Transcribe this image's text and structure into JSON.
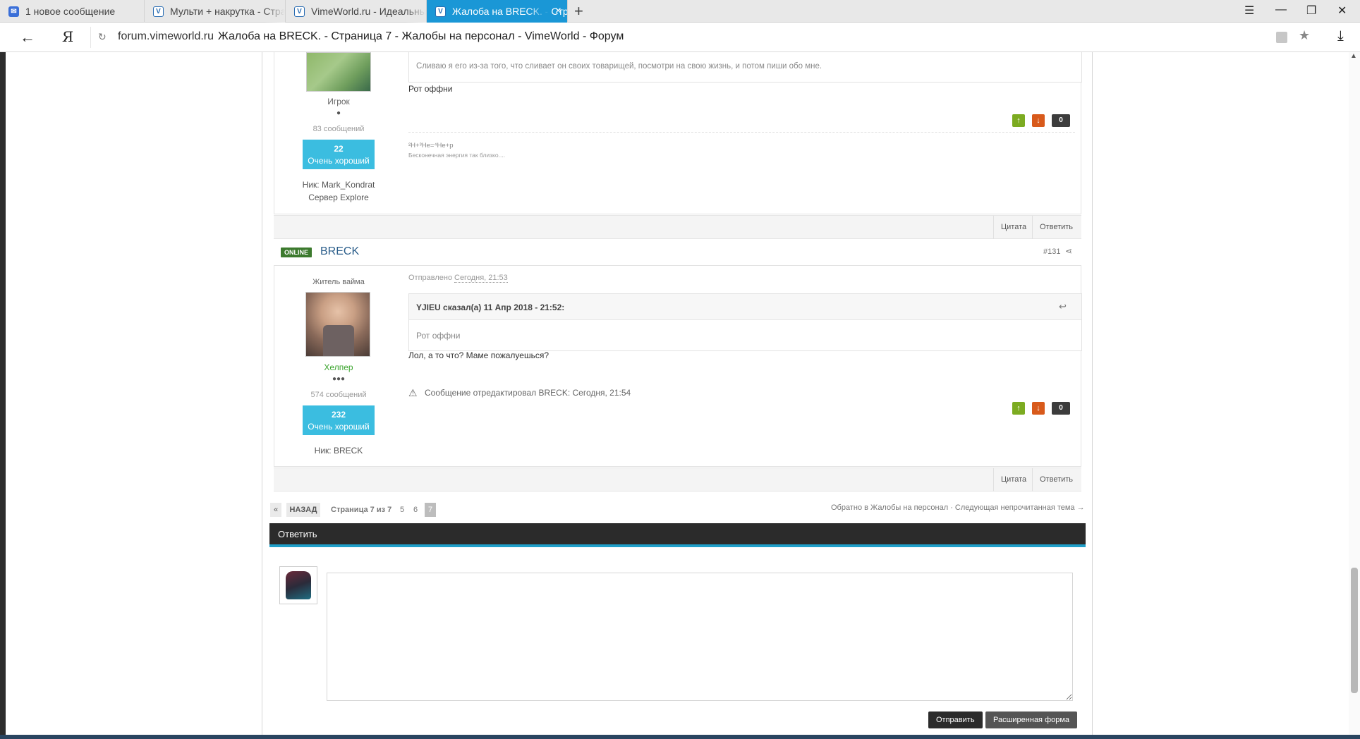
{
  "browser": {
    "tabs": [
      {
        "title": "1 новое сообщение",
        "icon": "mail-icon"
      },
      {
        "title": "Мульти + накрутка - Стран",
        "icon": "vimeworld-icon"
      },
      {
        "title": "VimeWorld.ru - Идеальные",
        "icon": "vimeworld-icon"
      },
      {
        "title": "Жалоба на BRECK. - Стра",
        "icon": "vimeworld-icon",
        "active": true
      }
    ],
    "new_tab": "+",
    "back": "←",
    "yandex": "Я",
    "reload": "↻",
    "domain": "forum.vimeworld.ru",
    "page_title": "Жалоба на BRECK. - Страница 7 - Жалобы на персонал - VimeWorld - Форум",
    "menu": "☰",
    "minimize": "—",
    "restore": "❐",
    "close": "✕",
    "star": "★",
    "download": "⤓"
  },
  "post1": {
    "rank": "Игрок",
    "pips": "●",
    "posts": "83 сообщений",
    "rep_value": "22",
    "rep_label": "Очень хороший",
    "nick": "Ник: Mark_Kondrat",
    "server": "Сервер Explore",
    "quote_text": "Сливаю я его из-за того, что сливает он своих товарищей, посмотри на свою жизнь, и потом пиши обо мне.",
    "body": "Рот оффни",
    "rep_count": "0",
    "signature_formula": "²H+³He=⁴He+p",
    "signature_text": "Бесконечная энергия так близко....",
    "quote_btn": "Цитата",
    "reply_btn": "Ответить"
  },
  "post2": {
    "online": "ONLINE",
    "author": "BRECK",
    "post_num": "#131",
    "title_rank": "Житель вайма",
    "sent_label": "Отправлено",
    "sent_date": "Сегодня, 21:53",
    "rank": "Хелпер",
    "pips": "●●●",
    "posts": "574 сообщений",
    "rep_value": "232",
    "rep_label": "Очень хороший",
    "nick": "Ник: BRECK",
    "quote_header": "YJIEU сказал(а) 11 Апр 2018 - 21:52:",
    "quote_text": "Рот оффни",
    "body": "Лол, а то что? Маме пожалуешься?",
    "edited": "Сообщение отредактировал BRECK: Сегодня, 21:54",
    "rep_count": "0",
    "quote_btn": "Цитата",
    "reply_btn": "Ответить"
  },
  "pagination": {
    "first": "«",
    "back": "НАЗАД",
    "page_info": "Страница 7 из 7",
    "pages": [
      "5",
      "6",
      "7"
    ],
    "back_link": "Обратно в Жалобы на персонал · Следующая непрочитанная тема →"
  },
  "reply": {
    "title": "Ответить",
    "textarea_value": "",
    "send": "Отправить",
    "advanced": "Расширенная форма"
  },
  "colors": {
    "accent": "#1f9fc9",
    "rep_badge": "#3bbde0",
    "online": "#3c7a2e",
    "helper_rank": "#3ca52f"
  }
}
